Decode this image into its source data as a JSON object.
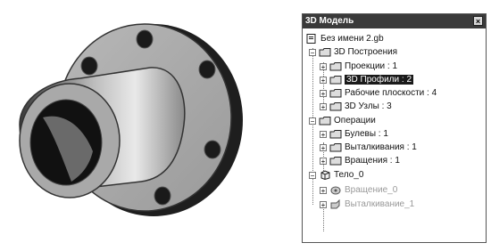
{
  "panel": {
    "title": "3D Модель",
    "close_label": "×"
  },
  "tree": {
    "root": "Без имени 2.gb",
    "groups": [
      {
        "label": "3D Построения",
        "expander": "−",
        "items": [
          {
            "label": "Проекции : 1",
            "expander": "+"
          },
          {
            "label": "3D Профили : 2",
            "expander": "+",
            "selected": true
          },
          {
            "label": "Рабочие плоскости : 4",
            "expander": "+"
          },
          {
            "label": "3D Узлы : 3",
            "expander": "+"
          }
        ]
      },
      {
        "label": "Операции",
        "expander": "−",
        "items": [
          {
            "label": "Булевы : 1",
            "expander": "+"
          },
          {
            "label": "Выталкивания : 1",
            "expander": "+"
          },
          {
            "label": "Вращения : 1",
            "expander": "+"
          }
        ]
      },
      {
        "label": "Тело_0",
        "expander": "−",
        "items": [
          {
            "label": "Вращение_0",
            "expander": "+",
            "disabled": true
          },
          {
            "label": "Выталкивание_1",
            "expander": "+",
            "disabled": true
          }
        ]
      }
    ]
  }
}
